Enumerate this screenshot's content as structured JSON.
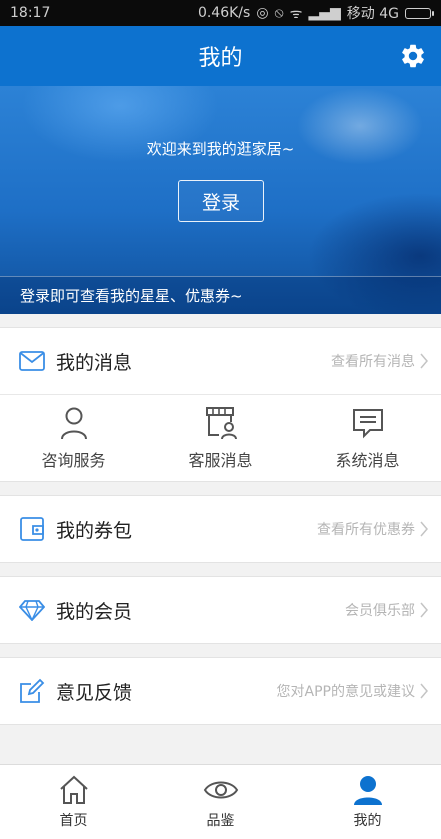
{
  "status_bar": {
    "time": "18:17",
    "speed": "0.46K/s",
    "carrier": "移动 4G"
  },
  "header": {
    "title": "我的",
    "settings_icon": "gear-icon"
  },
  "banner": {
    "welcome": "欢迎来到我的逛家居~",
    "login_button": "登录",
    "tip": "登录即可查看我的星星、优惠券~"
  },
  "messages": {
    "label": "我的消息",
    "hint": "查看所有消息",
    "items": [
      {
        "label": "咨询服务",
        "icon": "person-icon"
      },
      {
        "label": "客服消息",
        "icon": "store-service-icon"
      },
      {
        "label": "系统消息",
        "icon": "message-icon"
      }
    ]
  },
  "coupons": {
    "label": "我的券包",
    "hint": "查看所有优惠券"
  },
  "membership": {
    "label": "我的会员",
    "hint": "会员俱乐部"
  },
  "feedback": {
    "label": "意见反馈",
    "hint": "您对APP的意见或建议"
  },
  "tabbar": {
    "tabs": [
      {
        "label": "首页",
        "icon": "home-icon"
      },
      {
        "label": "品鉴",
        "icon": "eye-icon"
      },
      {
        "label": "我的",
        "icon": "user-icon",
        "active": true
      }
    ]
  },
  "colors": {
    "primary": "#0d72cf",
    "accent_icon": "#3a8ee6",
    "hint_text": "#b5b5b5"
  }
}
